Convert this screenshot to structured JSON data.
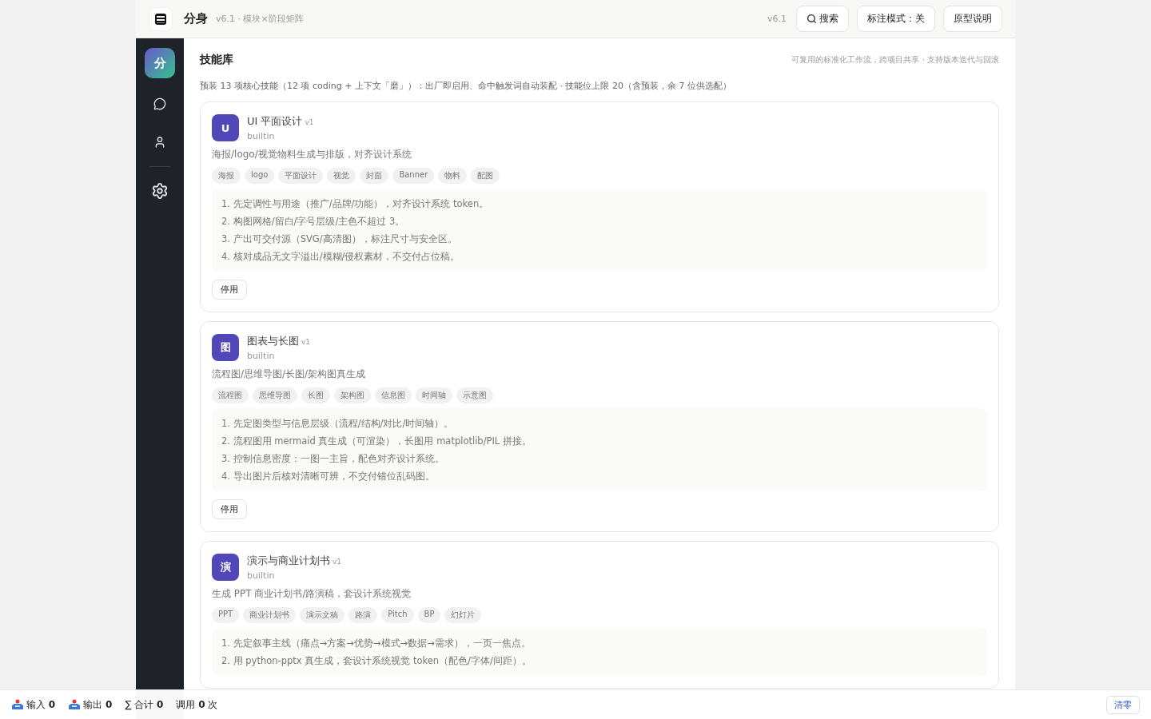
{
  "header": {
    "app_name": "分身",
    "subtitle": "v6.1 · 模块×阶段矩阵",
    "version": "v6.1",
    "buttons": [
      {
        "kind": "search",
        "label": "搜索"
      },
      {
        "kind": "plain",
        "label": "标注模式：关"
      },
      {
        "kind": "plain",
        "label": "原型说明"
      }
    ]
  },
  "sidebar": {
    "brand": "分",
    "items": [
      {
        "kind": "chat"
      },
      {
        "kind": "user"
      },
      {
        "kind": "divider"
      },
      {
        "kind": "settings"
      }
    ]
  },
  "page": {
    "title": "技能库",
    "tagline": "可复用的标准化工作流，跨项目共享 · 支持版本迭代与回滚",
    "intro": "预装 13 项核心技能（12 项 coding + 上下文「磨」）：出厂即启用、命中触发词自动装配 · 技能位上限 20（含预装，余 7 位供选配）"
  },
  "skills": [
    {
      "avatar": "U",
      "name": "UI 平面设计",
      "version": "v1",
      "source": "builtin",
      "description": "海报/logo/视觉物料生成与排版，对齐设计系统",
      "tags": [
        "海报",
        "logo",
        "平面设计",
        "视觉",
        "封面",
        "Banner",
        "物料",
        "配图"
      ],
      "steps": [
        "1. 先定调性与用途（推广/品牌/功能），对齐设计系统 token。",
        "2. 构图网格/留白/字号层级/主色不超过 3。",
        "3. 产出可交付源（SVG/高清图），标注尺寸与安全区。",
        "4. 核对成品无文字溢出/模糊/侵权素材，不交付占位稿。"
      ],
      "action": "停用"
    },
    {
      "avatar": "图",
      "name": "图表与长图",
      "version": "v1",
      "source": "builtin",
      "description": "流程图/思维导图/长图/架构图真生成",
      "tags": [
        "流程图",
        "思维导图",
        "长图",
        "架构图",
        "信息图",
        "时间轴",
        "示意图"
      ],
      "steps": [
        "1. 先定图类型与信息层级（流程/结构/对比/时间轴）。",
        "2. 流程图用 mermaid 真生成（可渲染），长图用 matplotlib/PIL 拼接。",
        "3. 控制信息密度：一图一主旨，配色对齐设计系统。",
        "4. 导出图片后核对清晰可辨，不交付错位乱码图。"
      ],
      "action": "停用"
    },
    {
      "avatar": "演",
      "name": "演示与商业计划书",
      "version": "v1",
      "source": "builtin",
      "description": "生成 PPT 商业计划书/路演稿，套设计系统视觉",
      "tags": [
        "PPT",
        "商业计划书",
        "演示文稿",
        "路演",
        "Pitch",
        "BP",
        "幻灯片"
      ],
      "steps": [
        "1. 先定叙事主线（痛点→方案→优势→模式→数据→需求），一页一焦点。",
        "2. 用 python-pptx 真生成，套设计系统视觉 token（配色/字体/间距）。"
      ]
    }
  ],
  "status_bar": {
    "stats": [
      {
        "kind": "input",
        "text": "输入 **0**"
      },
      {
        "kind": "output",
        "text": "输出 **0**"
      },
      {
        "kind": "plain",
        "text": "∑ 合计 **0**"
      },
      {
        "kind": "plain",
        "text": "调用 **0** 次"
      }
    ],
    "clear_button": "清零"
  }
}
